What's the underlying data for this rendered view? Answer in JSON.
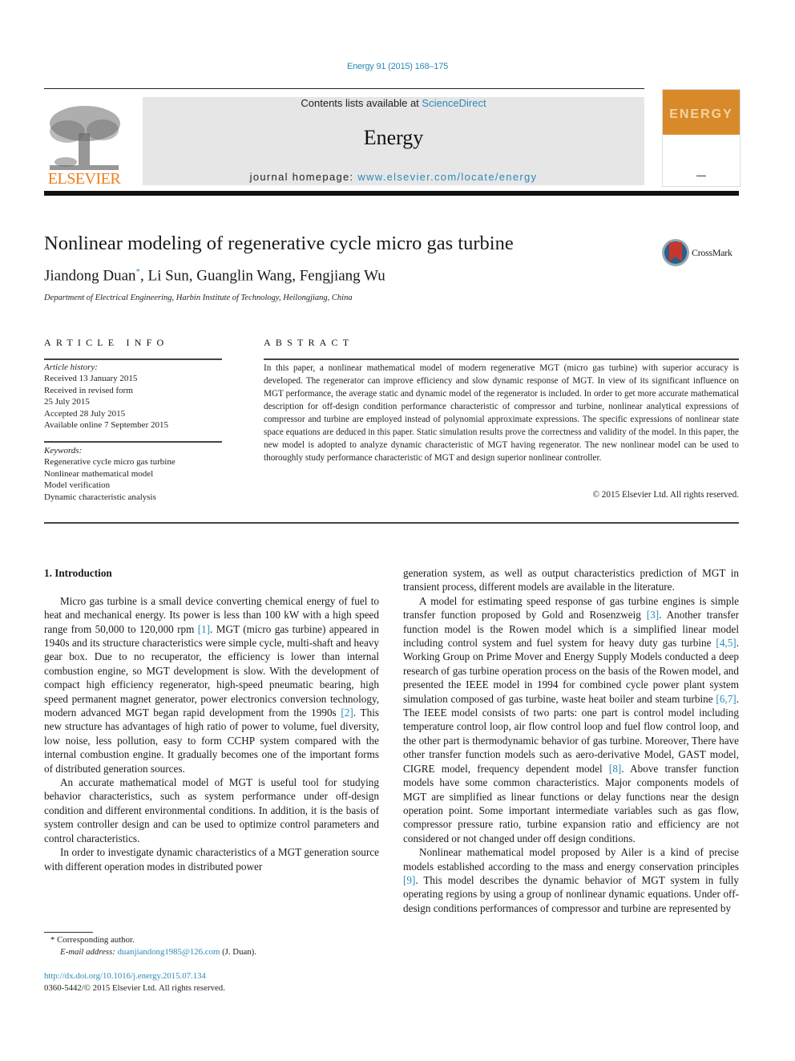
{
  "running_head": "Energy 91 (2015) 168–175",
  "masthead": {
    "contents_prefix": "Contents lists available at ",
    "contents_link": "ScienceDirect",
    "journal_name": "Energy",
    "homepage_prefix": "journal homepage: ",
    "homepage_link": "www.elsevier.com/locate/energy"
  },
  "publisher_logo_text": "ELSEVIER",
  "cover": {
    "title": "ENERGY",
    "band_color": "#d88a2a"
  },
  "colors": {
    "link": "#2a8ab8",
    "elsevier_orange": "#f07d1a",
    "masthead_bg": "#e6e6e6"
  },
  "article": {
    "title": "Nonlinear modeling of regenerative cycle micro gas turbine",
    "authors": [
      {
        "name": "Jiandong Duan",
        "mark": "*"
      },
      {
        "name": "Li Sun"
      },
      {
        "name": "Guanglin Wang"
      },
      {
        "name": "Fengjiang Wu"
      }
    ],
    "affiliation": "Department of Electrical Engineering, Harbin Institute of Technology, Heilongjiang, China",
    "crossmark_label": "CrossMark"
  },
  "article_info": {
    "heading": "ARTICLE INFO",
    "history_label": "Article history:",
    "history": [
      "Received 13 January 2015",
      "Received in revised form",
      "25 July 2015",
      "Accepted 28 July 2015",
      "Available online 7 September 2015"
    ],
    "keywords_label": "Keywords:",
    "keywords": [
      "Regenerative cycle micro gas turbine",
      "Nonlinear mathematical model",
      "Model verification",
      "Dynamic characteristic analysis"
    ]
  },
  "abstract": {
    "heading": "ABSTRACT",
    "text": "In this paper, a nonlinear mathematical model of modern regenerative MGT (micro gas turbine) with superior accuracy is developed. The regenerator can improve efficiency and slow dynamic response of MGT. In view of its significant influence on MGT performance, the average static and dynamic model of the regenerator is included. In order to get more accurate mathematical description for off-design condition performance characteristic of compressor and turbine, nonlinear analytical expressions of compressor and turbine are employed instead of polynomial approximate expressions. The specific expressions of nonlinear state space equations are deduced in this paper. Static simulation results prove the correctness and validity of the model. In this paper, the new model is adopted to analyze dynamic characteristic of MGT having regenerator. The new nonlinear model can be used to thoroughly study performance characteristic of MGT and design superior nonlinear controller.",
    "copyright": "© 2015 Elsevier Ltd. All rights reserved."
  },
  "body": {
    "section_heading": "1.  Introduction",
    "left_paragraphs": [
      {
        "parts": [
          {
            "t": "Micro gas turbine is a small device converting chemical energy of fuel to heat and mechanical energy. Its power is less than 100 kW with a high speed range from 50,000 to 120,000 rpm "
          },
          {
            "ref": "[1]"
          },
          {
            "t": ". MGT (micro gas turbine) appeared in 1940s and its structure characteristics were simple cycle, multi-shaft and heavy gear box. Due to no recuperator, the efficiency is lower than internal combustion engine, so MGT development is slow. With the development of compact high efficiency regenerator, high-speed pneumatic bearing, high speed permanent magnet generator, power electronics conversion technology, modern advanced MGT began rapid development from the 1990s "
          },
          {
            "ref": "[2]"
          },
          {
            "t": ". This new structure has advantages of high ratio of power to volume, fuel diversity, low noise, less pollution, easy to form CCHP system compared with the internal combustion engine. It gradually becomes one of the important forms of distributed generation sources."
          }
        ]
      },
      {
        "parts": [
          {
            "t": "An accurate mathematical model of MGT is useful tool for studying behavior characteristics, such as system performance under off-design condition and different environmental conditions. In addition, it is the basis of system controller design and can be used to optimize control parameters and control characteristics."
          }
        ]
      },
      {
        "parts": [
          {
            "t": "In order to investigate dynamic characteristics of a MGT generation source with different operation modes in distributed power"
          }
        ]
      }
    ],
    "right_paragraphs": [
      {
        "noindent": true,
        "parts": [
          {
            "t": "generation system, as well as output characteristics prediction of MGT in transient process, different models are available in the literature."
          }
        ]
      },
      {
        "parts": [
          {
            "t": "A model for estimating speed response of gas turbine engines is simple transfer function proposed by Gold and Rosenzweig "
          },
          {
            "ref": "[3]"
          },
          {
            "t": ". Another transfer function model is the Rowen model which is a simplified linear model including control system and fuel system for heavy duty gas turbine "
          },
          {
            "ref": "[4,5]"
          },
          {
            "t": ". Working Group on Prime Mover and Energy Supply Models conducted a deep research of gas turbine operation process on the basis of the Rowen model, and presented the IEEE model in 1994 for combined cycle power plant system simulation composed of gas turbine, waste heat boiler and steam turbine "
          },
          {
            "ref": "[6,7]"
          },
          {
            "t": ". The IEEE model consists of two parts: one part is control model including temperature control loop, air flow control loop and fuel flow control loop, and the other part is thermodynamic behavior of gas turbine. Moreover, There have other transfer function models such as aero-derivative Model, GAST model, CIGRE model, frequency dependent model "
          },
          {
            "ref": "[8]"
          },
          {
            "t": ". Above transfer function models have some common characteristics. Major components models of MGT are simplified as linear functions or delay functions near the design operation point. Some important intermediate variables such as gas flow, compressor pressure ratio, turbine expansion ratio and efficiency are not considered or not changed under off design conditions."
          }
        ]
      },
      {
        "parts": [
          {
            "t": "Nonlinear mathematical model proposed by Ailer is a kind of precise models established according to the mass and energy conservation principles "
          },
          {
            "ref": "[9]"
          },
          {
            "t": ". This model describes the dynamic behavior of MGT system in fully operating regions by using a group of nonlinear dynamic equations. Under off-design conditions performances of compressor and turbine are represented by"
          }
        ]
      }
    ]
  },
  "footnotes": {
    "mark": "*",
    "corresponding": "Corresponding author.",
    "email_label": "E-mail address:",
    "email": "duanjiandong1985@126.com",
    "email_suffix": " (J. Duan)."
  },
  "doi": {
    "url": "http://dx.doi.org/10.1016/j.energy.2015.07.134",
    "issn_line": "0360-5442/© 2015 Elsevier Ltd. All rights reserved."
  }
}
